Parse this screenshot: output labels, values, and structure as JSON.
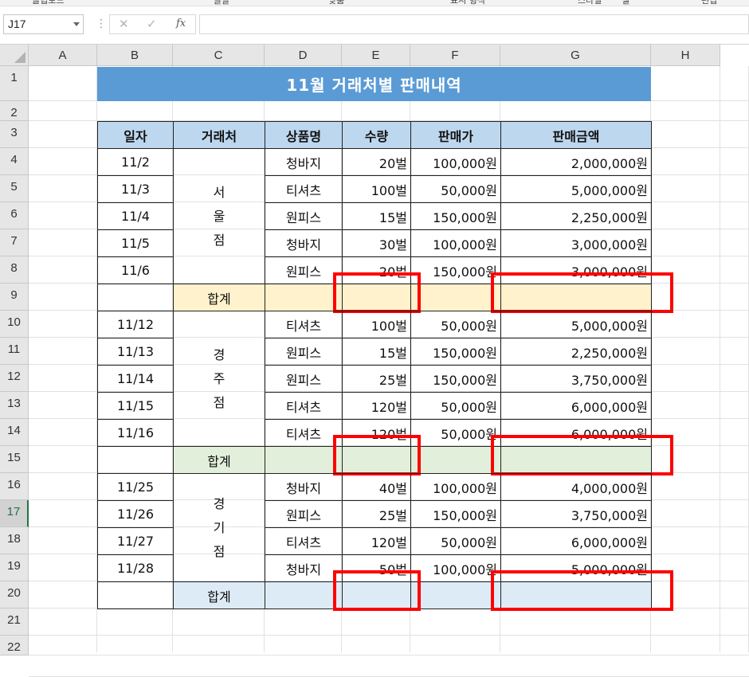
{
  "ribbon_fragments": [
    "클립보드",
    "글꼴",
    "맞춤",
    "표시 형식",
    "스타일",
    "셀",
    "편집"
  ],
  "formula_bar": {
    "name_box": "J17",
    "cancel_symbol": "✕",
    "enter_symbol": "✓",
    "fx_symbol": "fx",
    "formula": ""
  },
  "columns": [
    "A",
    "B",
    "C",
    "D",
    "E",
    "F",
    "G",
    "H"
  ],
  "rows": [
    "1",
    "2",
    "3",
    "4",
    "5",
    "6",
    "7",
    "8",
    "9",
    "10",
    "11",
    "12",
    "13",
    "14",
    "15",
    "16",
    "17",
    "18",
    "19",
    "20",
    "21",
    "22"
  ],
  "selected_row": "17",
  "sheet": {
    "title": "11월 거래처별 판매내역",
    "headers": [
      "일자",
      "거래처",
      "상품명",
      "수량",
      "판매가",
      "판매금액"
    ],
    "groups": [
      {
        "store_chars": [
          "서",
          "울",
          "점"
        ],
        "subtotal_label": "합계",
        "color": "#fff2cc",
        "rows": [
          [
            "11/2",
            "청바지",
            "20벌",
            "100,000원",
            "2,000,000원"
          ],
          [
            "11/3",
            "티셔츠",
            "100벌",
            "50,000원",
            "5,000,000원"
          ],
          [
            "11/4",
            "원피스",
            "15벌",
            "150,000원",
            "2,250,000원"
          ],
          [
            "11/5",
            "청바지",
            "30벌",
            "100,000원",
            "3,000,000원"
          ],
          [
            "11/6",
            "원피스",
            "20벌",
            "150,000원",
            "3,000,000원"
          ]
        ]
      },
      {
        "store_chars": [
          "경",
          "주",
          "점"
        ],
        "subtotal_label": "합계",
        "color": "#e2efda",
        "rows": [
          [
            "11/12",
            "티셔츠",
            "100벌",
            "50,000원",
            "5,000,000원"
          ],
          [
            "11/13",
            "원피스",
            "15벌",
            "150,000원",
            "2,250,000원"
          ],
          [
            "11/14",
            "원피스",
            "25벌",
            "150,000원",
            "3,750,000원"
          ],
          [
            "11/15",
            "티셔츠",
            "120벌",
            "50,000원",
            "6,000,000원"
          ],
          [
            "11/16",
            "티셔츠",
            "120벌",
            "50,000원",
            "6,000,000원"
          ]
        ]
      },
      {
        "store_chars": [
          "경",
          "기",
          "점"
        ],
        "subtotal_label": "합계",
        "color": "#ddebf7",
        "rows": [
          [
            "11/25",
            "청바지",
            "40벌",
            "100,000원",
            "4,000,000원"
          ],
          [
            "11/26",
            "원피스",
            "25벌",
            "150,000원",
            "3,750,000원"
          ],
          [
            "11/27",
            "티셔츠",
            "120벌",
            "50,000원",
            "6,000,000원"
          ],
          [
            "11/28",
            "청바지",
            "50벌",
            "100,000원",
            "5,000,000원"
          ]
        ]
      }
    ]
  },
  "highlight_color": "#ff0000"
}
